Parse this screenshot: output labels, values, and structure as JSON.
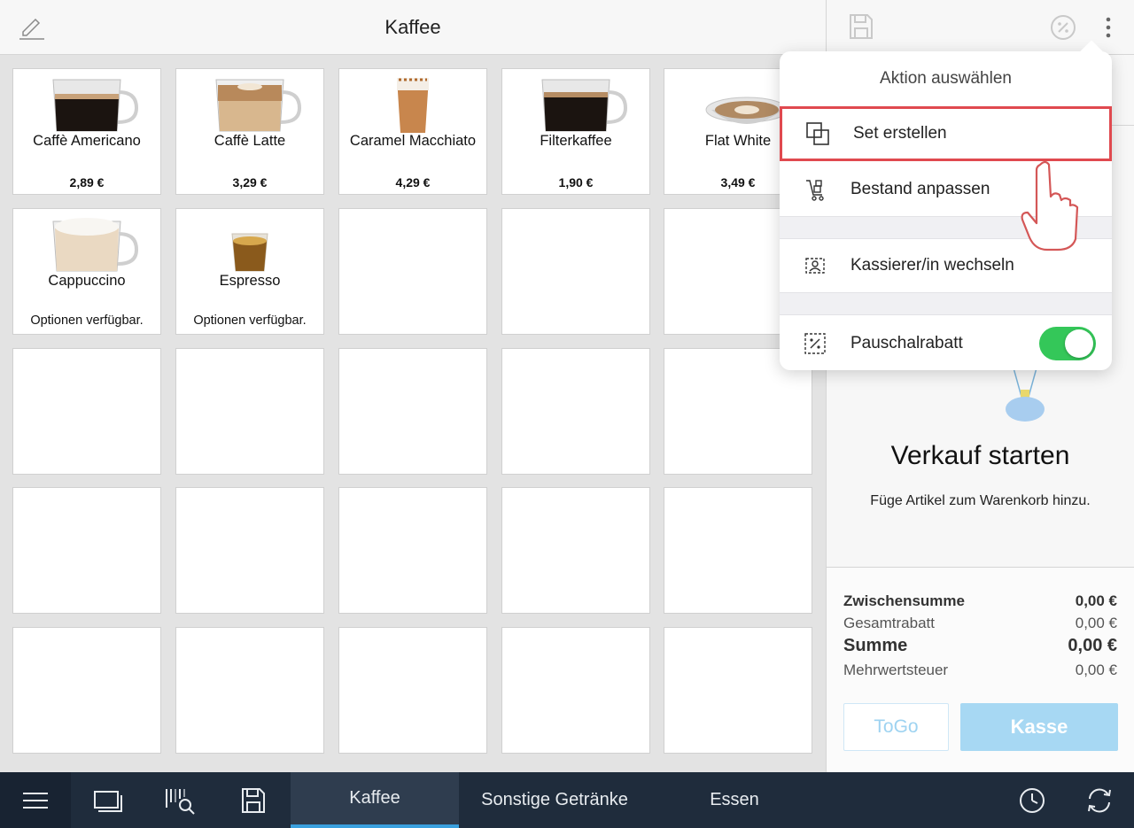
{
  "header": {
    "title": "Kaffee"
  },
  "products": [
    {
      "name": "Caffè Americano",
      "price": "2,89 €",
      "cup": "americano"
    },
    {
      "name": "Caffè Latte",
      "price": "3,29 €",
      "cup": "latte"
    },
    {
      "name": "Caramel Macchiato",
      "price": "4,29 €",
      "cup": "macchiato"
    },
    {
      "name": "Filterkaffee",
      "price": "1,90 €",
      "cup": "filter"
    },
    {
      "name": "Flat White",
      "price": "3,49 €",
      "cup": "flatwhite"
    },
    {
      "name": "Cappuccino",
      "note": "Optionen verfügbar.",
      "cup": "cappuccino"
    },
    {
      "name": "Espresso",
      "note": "Optionen verfügbar.",
      "cup": "espresso"
    }
  ],
  "cart": {
    "empty_title": "Verkauf starten",
    "empty_sub": "Füge Artikel zum Warenkorb hinzu.",
    "subtotal_label": "Zwischensumme",
    "subtotal_value": "0,00 €",
    "discount_label": "Gesamtrabatt",
    "discount_value": "0,00 €",
    "sum_label": "Summe",
    "sum_value": "0,00 €",
    "vat_label": "Mehrwertsteuer",
    "vat_value": "0,00 €",
    "togo_label": "ToGo",
    "checkout_label": "Kasse"
  },
  "menu": {
    "title": "Aktion auswählen",
    "items": [
      {
        "label": "Set erstellen",
        "icon": "set-icon"
      },
      {
        "label": "Bestand anpassen",
        "icon": "stock-icon"
      },
      {
        "label": "Kassierer/in wechseln",
        "icon": "cashier-switch-icon"
      },
      {
        "label": "Pauschalrabatt",
        "icon": "flat-discount-icon",
        "toggle": true
      }
    ]
  },
  "bottom_tabs": [
    {
      "label": "Kaffee",
      "active": true
    },
    {
      "label": "Sonstige Getränke",
      "active": false
    },
    {
      "label": "Essen",
      "active": false
    }
  ],
  "colors": {
    "accent": "#3aa0de",
    "bottombar": "#1f2c3c",
    "toggle_on": "#34c759",
    "highlight": "#e0494f",
    "checkout": "#a7d8f3"
  }
}
